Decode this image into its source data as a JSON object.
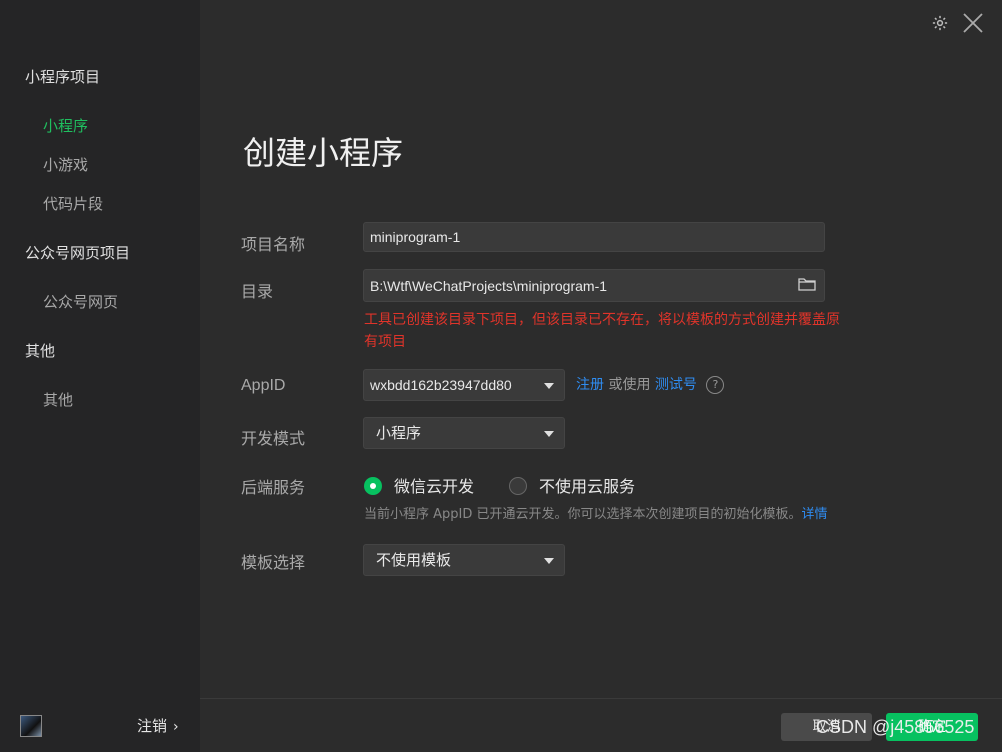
{
  "sidebar": {
    "groups": [
      {
        "label": "小程序项目",
        "items": [
          "小程序",
          "小游戏",
          "代码片段"
        ]
      },
      {
        "label": "公众号网页项目",
        "items": [
          "公众号网页"
        ]
      },
      {
        "label": "其他",
        "items": [
          "其他"
        ]
      }
    ],
    "active_item": "小程序",
    "logout_label": "注销"
  },
  "page": {
    "title": "创建小程序"
  },
  "form": {
    "project_name": {
      "label": "项目名称",
      "value": "miniprogram-1"
    },
    "directory": {
      "label": "目录",
      "value": "B:\\Wtf\\WeChatProjects\\miniprogram-1"
    },
    "directory_warning": "工具已创建该目录下项目，但该目录已不存在，将以模板的方式创建并覆盖原有项目",
    "appid": {
      "label": "AppID",
      "value": "wxbdd162b23947dd80",
      "register_link": "注册",
      "or_use": "或使用",
      "test_link": "测试号",
      "help": "?"
    },
    "dev_mode": {
      "label": "开发模式",
      "value": "小程序"
    },
    "backend": {
      "label": "后端服务",
      "option_cloud": "微信云开发",
      "option_none": "不使用云服务",
      "selected": "微信云开发",
      "note": "当前小程序 AppID 已开通云开发。你可以选择本次创建项目的初始化模板。",
      "details_link": "详情"
    },
    "template": {
      "label": "模板选择",
      "value": "不使用模板"
    }
  },
  "buttons": {
    "cancel": "取消",
    "confirm": "确定"
  },
  "watermark": "CSDN @j45856525",
  "colors": {
    "accent_green": "#07c160",
    "link_blue": "#2f8cf0",
    "warning_red": "#e0342a"
  }
}
